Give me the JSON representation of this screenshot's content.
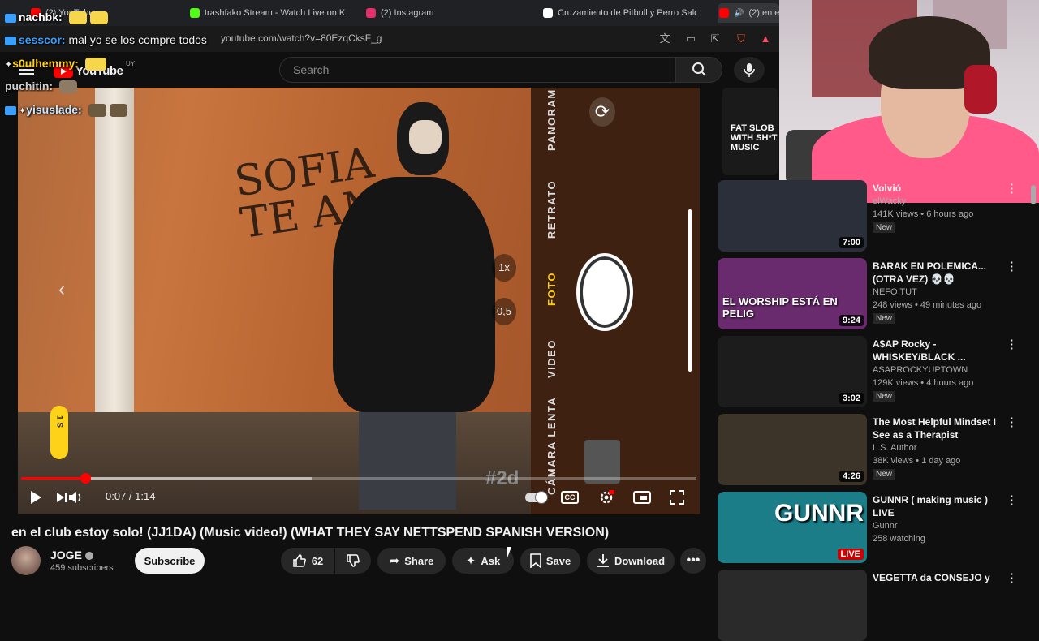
{
  "browser": {
    "tabs": [
      {
        "label": "(2) YouTube",
        "color": "#ff0000"
      },
      {
        "label": "trashfako Stream - Watch Live on K",
        "color": "#53fc18"
      },
      {
        "label": "(2) Instagram",
        "color": "#e1306c"
      },
      {
        "label": "Cruzamiento de Pitbull y Perro Salc",
        "color": "#ffffff"
      },
      {
        "label": "(2) en el",
        "color": "#ff0000"
      }
    ],
    "url": "youtube.com/watch?v=80EzqCksF_g"
  },
  "youtube": {
    "logo_text": "YouTube",
    "country": "UY",
    "search_placeholder": "Search"
  },
  "chat": [
    {
      "user": "nachbk:",
      "message": "",
      "color": "#ffffff"
    },
    {
      "user": "sesscor:",
      "message": "mal yo se los compre todos",
      "color": "#3aa0ff"
    },
    {
      "user": "s0ulhemmy:",
      "message": "",
      "color": "#ffd21a"
    },
    {
      "user": "puchitin:",
      "message": "",
      "color": "#cfcfcf"
    },
    {
      "user": "yisuslade:",
      "message": "",
      "color": "#cfe6ff"
    }
  ],
  "video": {
    "graffiti": "SOFIA\nTE AMO",
    "camera_modes": [
      "PANORAMA",
      "RETRATO",
      "FOTO",
      "VIDEO",
      "CÁMARA LENTA"
    ],
    "zoom_1x": "1x",
    "zoom_05": "0,5",
    "timer": "1 S",
    "watermark": "#2d",
    "current_time": "0:07",
    "duration": "1:14",
    "time_display": "0:07 / 1:14",
    "progress_fraction": 0.095,
    "buffered_fraction": 0.43,
    "title": "en el club estoy solo! (JJ1DA) (Music video!) (WHAT THEY SAY NETTSPEND SPANISH VERSION)"
  },
  "channel": {
    "name": "JOGE",
    "subscribers": "459 subscribers",
    "subscribe_label": "Subscribe"
  },
  "actions": {
    "likes": "62",
    "share": "Share",
    "ask": "Ask",
    "save": "Save",
    "download": "Download"
  },
  "webcam_overlay": {
    "poster_text": "FAT SLOB WITH SH*T MUSIC"
  },
  "recommendations": [
    {
      "title": "Volvió",
      "channel": "elWacky",
      "meta": "141K views • 6 hours ago",
      "badge": "New",
      "duration": "7:00",
      "thumb_color": "#2b2f3a"
    },
    {
      "title": "BARAK EN POLEMICA... (OTRA VEZ) 💀💀",
      "channel": "NEFO TUT",
      "meta": "248 views • 49 minutes ago",
      "badge": "New",
      "duration": "9:24",
      "thumb_text": "EL WORSHIP ESTÁ EN PELIG",
      "thumb_color": "#6a2a6e"
    },
    {
      "title": "A$AP Rocky - WHISKEY/BLACK ...",
      "channel": "ASAPROCKYUPTOWN",
      "meta": "129K views • 4 hours ago",
      "badge": "New",
      "duration": "3:02",
      "thumb_color": "#1c1c1c"
    },
    {
      "title": "The Most Helpful Mindset I See as a Therapist",
      "channel": "L.S. Author",
      "meta": "38K views • 1 day ago",
      "badge": "New",
      "duration": "4:26",
      "thumb_color": "#3c3329"
    },
    {
      "title": "GUNNR ( making music ) LIVE",
      "channel": "Gunnr",
      "meta": "258 watching",
      "badge": "",
      "duration": "LIVE",
      "thumb_text": "GUNNR",
      "thumb_color": "#1a7d88"
    },
    {
      "title": "VEGETTA da CONSEJO y",
      "channel": "",
      "meta": "",
      "badge": "",
      "duration": "",
      "thumb_color": "#2a2a2a"
    }
  ]
}
